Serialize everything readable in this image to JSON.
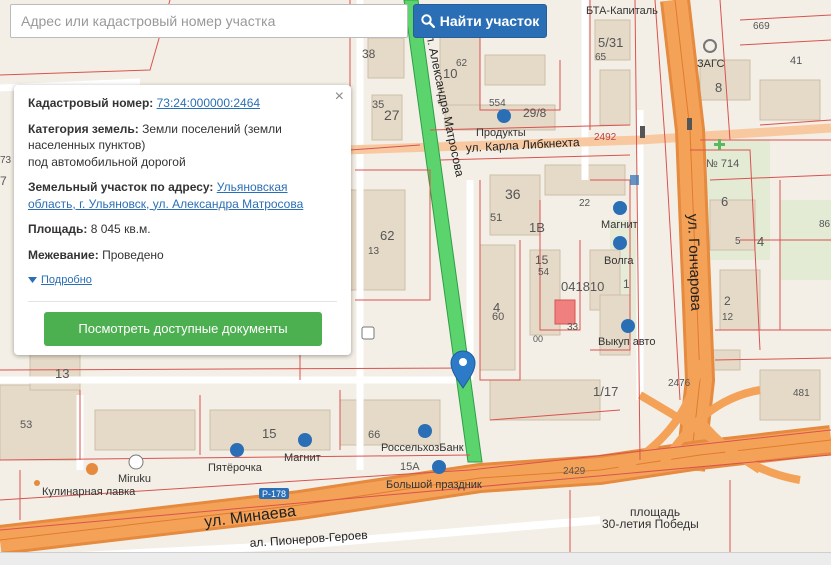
{
  "search": {
    "placeholder": "Адрес или кадастровый номер участка",
    "button_label": "Найти участок",
    "button_icon": "search-icon"
  },
  "popup": {
    "close_symbol": "×",
    "cadastral_label": "Кадастровый номер:",
    "cadastral_value": "73:24:000000:2464",
    "category_label": "Категория земель:",
    "category_value_1": "Земли поселений (земли",
    "category_value_2": "населенных пунктов)",
    "category_value_3": "под автомобильной дорогой",
    "address_label": "Земельный участок по адресу:",
    "address_value_1": "Ульяновская",
    "address_value_2": "область, г. Ульяновск, ул. Александра Матросова",
    "area_label": "Площадь:",
    "area_value": "8 045 кв.м.",
    "survey_label": "Межевание:",
    "survey_value": "Проведено",
    "more_label": "Подробно",
    "docs_button": "Посмотреть доступные документы"
  },
  "map": {
    "streets": {
      "matrosova": "ул. Александра Матросова",
      "libknekhta": "ул. Карла Либкнехта",
      "goncharova": "ул. Гончарова",
      "minaeva": "ул. Минаева",
      "pionerov": "ал. Пионеров-Героев",
      "road_badge": "Р-178"
    },
    "pois": {
      "bta": "БТА-Капиталь",
      "zags": "ЗАГС",
      "produkty": "Продукты",
      "magnit_top": "Магнит",
      "volga": "Волга",
      "vykup": "Выкуп авто",
      "pyaterochka": "Пятёрочка",
      "magnit_bottom": "Магнит",
      "miruku": "Miruku",
      "kulinar": "Кулинарная лавка",
      "bank": "РоссельхозБанк",
      "prazdnik": "Большой праздник",
      "square_1": "площадь",
      "square_2": "30-летия Победы"
    },
    "house_numbers": [
      "38",
      "10",
      "62",
      "5/31",
      "65",
      "669",
      "41",
      "8",
      "35",
      "27",
      "554",
      "29/8",
      "73",
      "7",
      "№ 714",
      "6",
      "4",
      "36",
      "51",
      "1В",
      "22",
      "86",
      "13",
      "62",
      "5",
      "15",
      "54",
      "041810",
      "1",
      "2",
      "12",
      "60",
      "4",
      "33",
      "00",
      "13",
      "53",
      "15",
      "66",
      "15А",
      "1/17",
      "2476",
      "481",
      "2429"
    ],
    "parcel_codes": [
      "2492",
      "041810"
    ],
    "colors": {
      "background": "#f3efe6",
      "building": "#e4d8c6",
      "road_major": "#f5a259",
      "road_minor": "#ffffff",
      "parcel_line": "#d9534f",
      "highlight": "#5bd46e",
      "marker": "#2d7bc8"
    }
  }
}
